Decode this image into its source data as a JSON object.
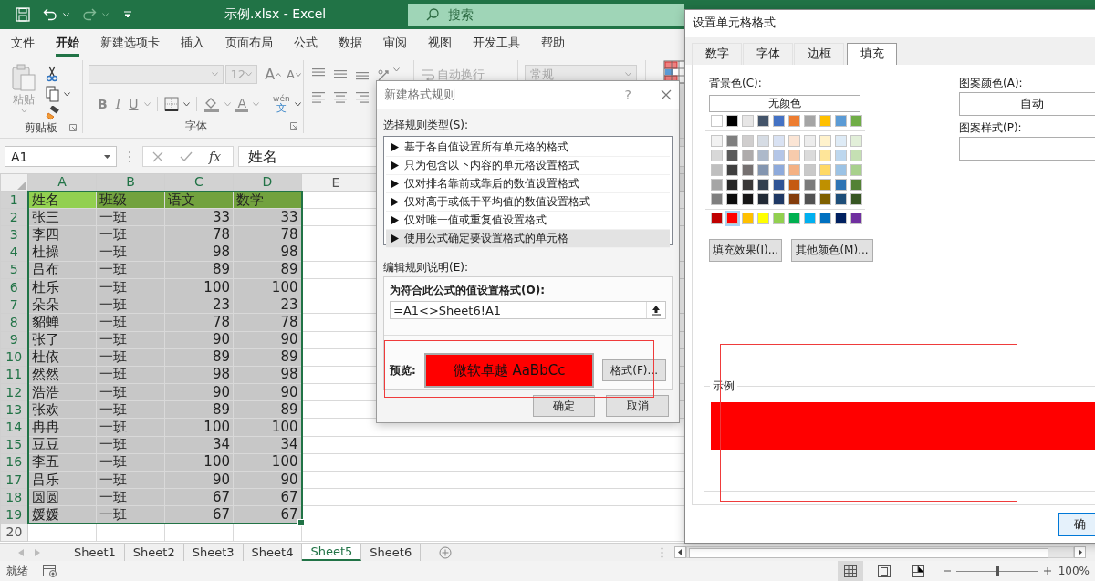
{
  "title_bar": {
    "title": "示例.xlsx - Excel",
    "search": {
      "placeholder": "搜索"
    }
  },
  "menu_tabs": [
    {
      "label": "文件",
      "selected": false
    },
    {
      "label": "开始",
      "selected": true
    },
    {
      "label": "新建选项卡",
      "selected": false
    },
    {
      "label": "插入",
      "selected": false
    },
    {
      "label": "页面布局",
      "selected": false
    },
    {
      "label": "公式",
      "selected": false
    },
    {
      "label": "数据",
      "selected": false
    },
    {
      "label": "审阅",
      "selected": false
    },
    {
      "label": "视图",
      "selected": false
    },
    {
      "label": "开发工具",
      "selected": false
    },
    {
      "label": "帮助",
      "selected": false
    }
  ],
  "ribbon": {
    "clipboard": {
      "paste": "粘贴",
      "group_label": "剪贴板"
    },
    "font": {
      "size": "12",
      "grow": "A",
      "shrink": "A",
      "bold": "B",
      "italic": "I",
      "underline": "U",
      "font_color": "A",
      "phonetic_top": "wén",
      "phonetic_bottom": "文",
      "group_label": "字体"
    },
    "alignment": {
      "wrap_text": "自动换行"
    },
    "number": {
      "format": "常规"
    }
  },
  "formula_bar": {
    "name_box": "A1",
    "function": "fx",
    "formula": "姓名"
  },
  "grid": {
    "columns": [
      {
        "label": "A",
        "selected": true,
        "kind": "text"
      },
      {
        "label": "B",
        "selected": true,
        "kind": "text"
      },
      {
        "label": "C",
        "selected": true,
        "kind": "number"
      },
      {
        "label": "D",
        "selected": true,
        "kind": "number"
      },
      {
        "label": "E",
        "selected": false,
        "kind": "text"
      }
    ],
    "rows": [
      {
        "number": "1",
        "selected": true,
        "color": "#92d050",
        "cells": [
          "姓名",
          "班级",
          "语文",
          "数学"
        ]
      },
      {
        "number": "2",
        "selected": true,
        "cells": [
          "张三",
          "一班",
          "33",
          "33"
        ]
      },
      {
        "number": "3",
        "selected": true,
        "cells": [
          "李四",
          "一班",
          "78",
          "78"
        ]
      },
      {
        "number": "4",
        "selected": true,
        "cells": [
          "杜操",
          "一班",
          "98",
          "98"
        ]
      },
      {
        "number": "5",
        "selected": true,
        "cells": [
          "吕布",
          "一班",
          "89",
          "89"
        ]
      },
      {
        "number": "6",
        "selected": true,
        "cells": [
          "杜乐",
          "一班",
          "100",
          "100"
        ]
      },
      {
        "number": "7",
        "selected": true,
        "cells": [
          "朵朵",
          "一班",
          "23",
          "23"
        ]
      },
      {
        "number": "8",
        "selected": true,
        "cells": [
          "貂蝉",
          "一班",
          "78",
          "78"
        ]
      },
      {
        "number": "9",
        "selected": true,
        "cells": [
          "张了",
          "一班",
          "90",
          "90"
        ]
      },
      {
        "number": "10",
        "selected": true,
        "cells": [
          "杜依",
          "一班",
          "89",
          "89"
        ]
      },
      {
        "number": "11",
        "selected": true,
        "cells": [
          "然然",
          "一班",
          "98",
          "98"
        ]
      },
      {
        "number": "12",
        "selected": true,
        "cells": [
          "浩浩",
          "一班",
          "90",
          "90"
        ]
      },
      {
        "number": "13",
        "selected": true,
        "cells": [
          "张欢",
          "一班",
          "89",
          "89"
        ]
      },
      {
        "number": "14",
        "selected": true,
        "cells": [
          "冉冉",
          "一班",
          "100",
          "100"
        ]
      },
      {
        "number": "15",
        "selected": true,
        "cells": [
          "豆豆",
          "一班",
          "34",
          "34"
        ]
      },
      {
        "number": "16",
        "selected": true,
        "cells": [
          "李五",
          "一班",
          "100",
          "100"
        ]
      },
      {
        "number": "17",
        "selected": true,
        "cells": [
          "吕乐",
          "一班",
          "90",
          "90"
        ]
      },
      {
        "number": "18",
        "selected": true,
        "cells": [
          "圆圆",
          "一班",
          "67",
          "67"
        ]
      },
      {
        "number": "19",
        "selected": true,
        "cells": [
          "媛媛",
          "一班",
          "67",
          "67"
        ]
      },
      {
        "number": "20",
        "selected": false
      }
    ]
  },
  "sheet_tabs": [
    {
      "label": "Sheet1",
      "selected": false
    },
    {
      "label": "Sheet2",
      "selected": false
    },
    {
      "label": "Sheet3",
      "selected": false
    },
    {
      "label": "Sheet4",
      "selected": false
    },
    {
      "label": "Sheet5",
      "selected": true
    },
    {
      "label": "Sheet6",
      "selected": false
    }
  ],
  "status_bar": {
    "status": "就绪",
    "views": [
      {
        "kind": "normal",
        "selected": true
      },
      {
        "kind": "page_layout",
        "selected": false
      },
      {
        "kind": "page_break",
        "selected": false
      }
    ],
    "zoom": {
      "level": 0.5,
      "reading": "100%"
    }
  },
  "rule_dialog": {
    "title": "新建格式规则",
    "help": "?",
    "rule_type_label": "选择规则类型(S):",
    "rule_types": [
      {
        "label": "基于各自值设置所有单元格的格式",
        "selected": false
      },
      {
        "label": "只为包含以下内容的单元格设置格式",
        "selected": false
      },
      {
        "label": "仅对排名靠前或靠后的数值设置格式",
        "selected": false
      },
      {
        "label": "仅对高于或低于平均值的数值设置格式",
        "selected": false
      },
      {
        "label": "仅对唯一值或重复值设置格式",
        "selected": false
      },
      {
        "label": "使用公式确定要设置格式的单元格",
        "selected": true
      }
    ],
    "description_label": "编辑规则说明(E):",
    "formula_label": "为符合此公式的值设置格式(O):",
    "formula": "=A1<>Sheet6!A1",
    "preview_label": "预览:",
    "preview_text": "微软卓越 AaBbCc",
    "format_button": "格式(F)...",
    "ok": "确定",
    "cancel": "取消"
  },
  "format_dialog": {
    "title": "设置单元格格式",
    "tabs": [
      {
        "label": "数字",
        "selected": false
      },
      {
        "label": "字体",
        "selected": false
      },
      {
        "label": "边框",
        "selected": false
      },
      {
        "label": "填充",
        "selected": true
      }
    ],
    "background_label": "背景色(C):",
    "no_color": "无颜色",
    "palette": {
      "groups": [
        {
          "rows": [
            [
              {
                "color": "#ffffff",
                "selected": false
              },
              {
                "color": "#000000",
                "selected": false
              },
              {
                "color": "#e7e6e6",
                "selected": false
              },
              {
                "color": "#44546a",
                "selected": false
              },
              {
                "color": "#4472c4",
                "selected": false
              },
              {
                "color": "#ed7d31",
                "selected": false
              },
              {
                "color": "#a5a5a5",
                "selected": false
              },
              {
                "color": "#ffc000",
                "selected": false
              },
              {
                "color": "#5b9bd5",
                "selected": false
              },
              {
                "color": "#70ad47",
                "selected": false
              }
            ]
          ]
        },
        {
          "rows": [
            [
              {
                "color": "#f2f2f2",
                "selected": false
              },
              {
                "color": "#7f7f7f",
                "selected": false
              },
              {
                "color": "#d0cece",
                "selected": false
              },
              {
                "color": "#d6dce4",
                "selected": false
              },
              {
                "color": "#d9e2f3",
                "selected": false
              },
              {
                "color": "#fbe5d5",
                "selected": false
              },
              {
                "color": "#ededed",
                "selected": false
              },
              {
                "color": "#fff2cc",
                "selected": false
              },
              {
                "color": "#deebf6",
                "selected": false
              },
              {
                "color": "#e2efd9",
                "selected": false
              }
            ],
            [
              {
                "color": "#d8d8d8",
                "selected": false
              },
              {
                "color": "#595959",
                "selected": false
              },
              {
                "color": "#aeabab",
                "selected": false
              },
              {
                "color": "#adb9ca",
                "selected": false
              },
              {
                "color": "#b4c6e7",
                "selected": false
              },
              {
                "color": "#f7cbac",
                "selected": false
              },
              {
                "color": "#dbdbdb",
                "selected": false
              },
              {
                "color": "#fee599",
                "selected": false
              },
              {
                "color": "#bdd7ee",
                "selected": false
              },
              {
                "color": "#c5e0b3",
                "selected": false
              }
            ],
            [
              {
                "color": "#bfbfbf",
                "selected": false
              },
              {
                "color": "#3f3f3f",
                "selected": false
              },
              {
                "color": "#757070",
                "selected": false
              },
              {
                "color": "#8496b0",
                "selected": false
              },
              {
                "color": "#8eaadb",
                "selected": false
              },
              {
                "color": "#f4b183",
                "selected": false
              },
              {
                "color": "#c9c9c9",
                "selected": false
              },
              {
                "color": "#ffd965",
                "selected": false
              },
              {
                "color": "#9cc3e5",
                "selected": false
              },
              {
                "color": "#a8d08d",
                "selected": false
              }
            ],
            [
              {
                "color": "#a5a5a5",
                "selected": false
              },
              {
                "color": "#262626",
                "selected": false
              },
              {
                "color": "#3a3838",
                "selected": false
              },
              {
                "color": "#323f4f",
                "selected": false
              },
              {
                "color": "#2f5496",
                "selected": false
              },
              {
                "color": "#c55a11",
                "selected": false
              },
              {
                "color": "#7b7b7b",
                "selected": false
              },
              {
                "color": "#bf9000",
                "selected": false
              },
              {
                "color": "#2e75b5",
                "selected": false
              },
              {
                "color": "#538135",
                "selected": false
              }
            ],
            [
              {
                "color": "#7f7f7f",
                "selected": false
              },
              {
                "color": "#0c0c0c",
                "selected": false
              },
              {
                "color": "#171616",
                "selected": false
              },
              {
                "color": "#222a35",
                "selected": false
              },
              {
                "color": "#1f3864",
                "selected": false
              },
              {
                "color": "#833c0b",
                "selected": false
              },
              {
                "color": "#525252",
                "selected": false
              },
              {
                "color": "#7f6000",
                "selected": false
              },
              {
                "color": "#1e4e79",
                "selected": false
              },
              {
                "color": "#375623",
                "selected": false
              }
            ]
          ]
        },
        {
          "rows": [
            [
              {
                "color": "#c00000",
                "selected": false
              },
              {
                "color": "#ff0000",
                "selected": true
              },
              {
                "color": "#ffc000",
                "selected": false
              },
              {
                "color": "#ffff00",
                "selected": false
              },
              {
                "color": "#92d050",
                "selected": false
              },
              {
                "color": "#00b050",
                "selected": false
              },
              {
                "color": "#00b0f0",
                "selected": false
              },
              {
                "color": "#0070c0",
                "selected": false
              },
              {
                "color": "#002060",
                "selected": false
              },
              {
                "color": "#7030a0",
                "selected": false
              }
            ]
          ]
        }
      ]
    },
    "fill_effects": "填充效果(I)...",
    "more_colors": "其他颜色(M)...",
    "pattern_color_label": "图案颜色(A):",
    "pattern_color": "自动",
    "pattern_style_label": "图案样式(P):",
    "sample_label": "示例",
    "ok": "确"
  }
}
